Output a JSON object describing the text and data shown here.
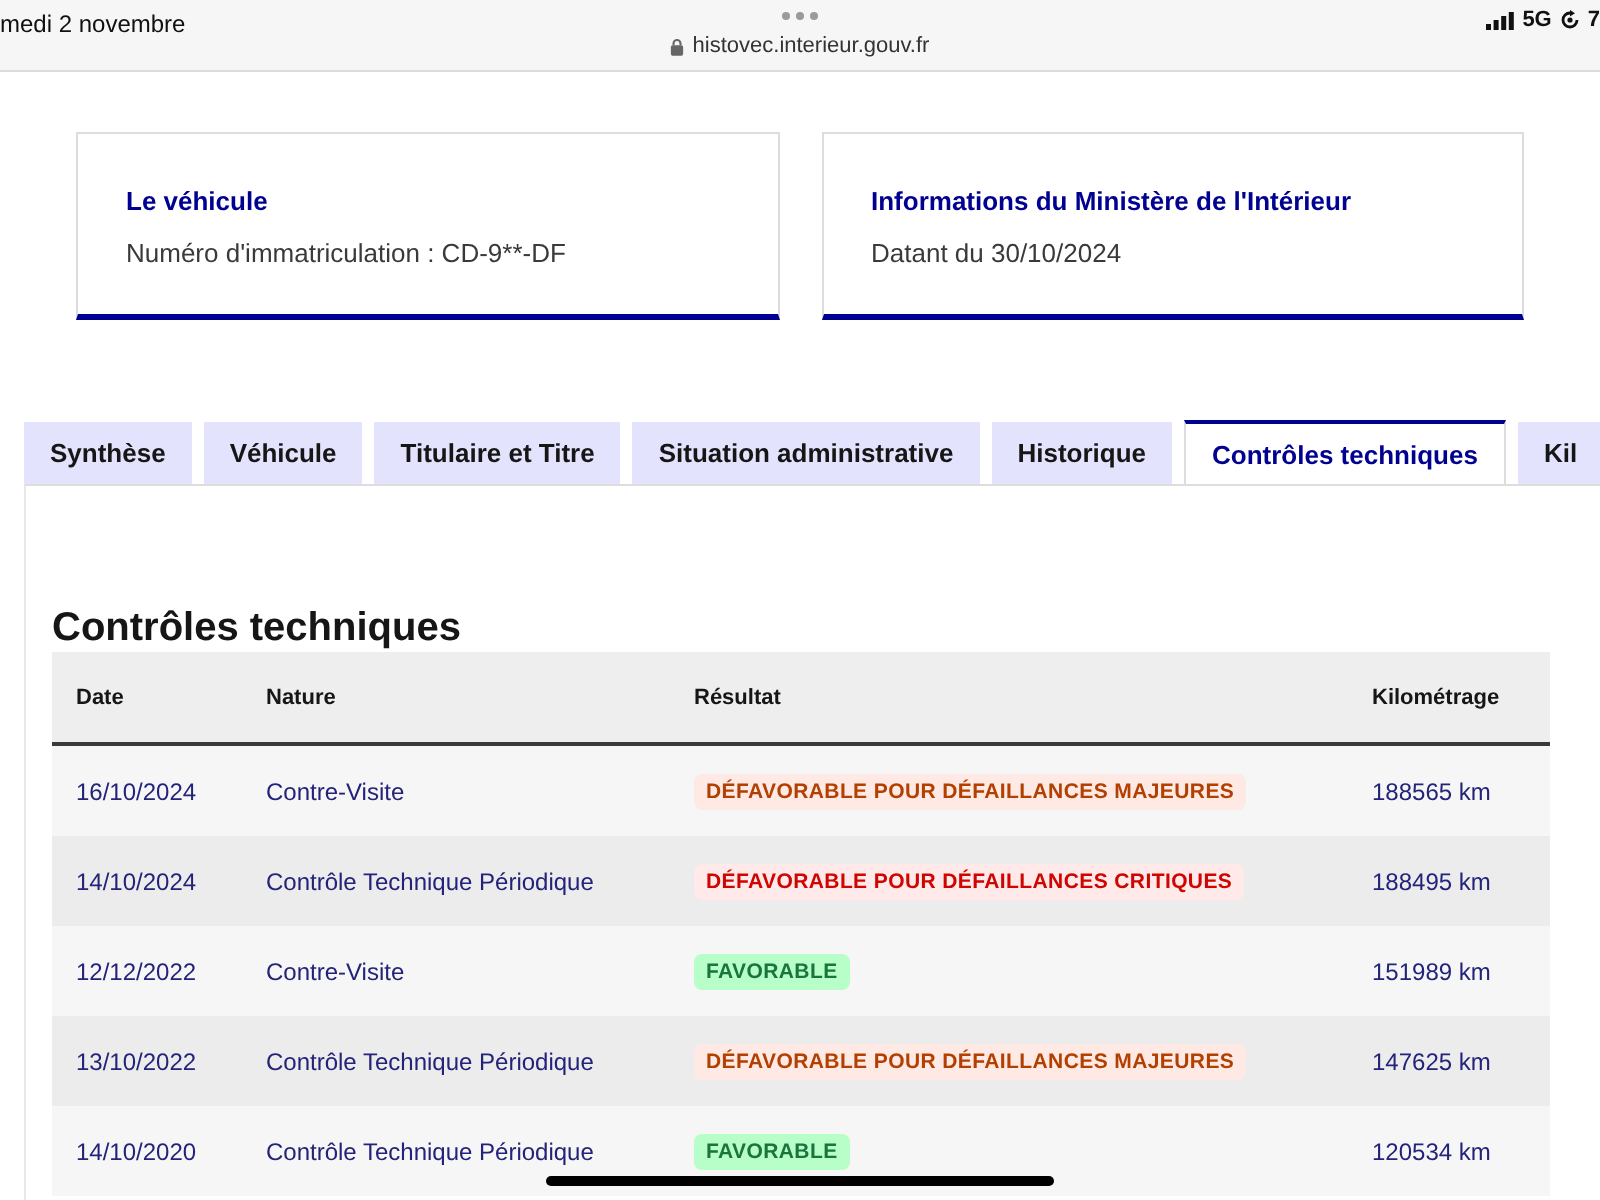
{
  "status_bar": {
    "date": "medi 2 novembre",
    "url": "histovec.interieur.gouv.fr",
    "network": "5G",
    "battery": "7"
  },
  "cards": [
    {
      "title": "Le véhicule",
      "text": "Numéro d'immatriculation : CD-9**-DF"
    },
    {
      "title": "Informations du Ministère de l'Intérieur",
      "text": "Datant du 30/10/2024"
    }
  ],
  "tabs": [
    {
      "label": "Synthèse",
      "selected": false
    },
    {
      "label": "Véhicule",
      "selected": false
    },
    {
      "label": "Titulaire et Titre",
      "selected": false
    },
    {
      "label": "Situation administrative",
      "selected": false
    },
    {
      "label": "Historique",
      "selected": false
    },
    {
      "label": "Contrôles techniques",
      "selected": true
    },
    {
      "label": "Kil",
      "selected": false
    }
  ],
  "section": {
    "title": "Contrôles techniques",
    "table": {
      "columns": [
        "Date",
        "Nature",
        "Résultat",
        "Kilométrage"
      ],
      "rows": [
        {
          "date": "16/10/2024",
          "nature": "Contre-Visite",
          "result": {
            "text": "DÉFAVORABLE POUR DÉFAILLANCES MAJEURES",
            "kind": "warning"
          },
          "mileage": "188565 km"
        },
        {
          "date": "14/10/2024",
          "nature": "Contrôle Technique Périodique",
          "result": {
            "text": "DÉFAVORABLE POUR DÉFAILLANCES CRITIQUES",
            "kind": "error"
          },
          "mileage": "188495 km"
        },
        {
          "date": "12/12/2022",
          "nature": "Contre-Visite",
          "result": {
            "text": "FAVORABLE",
            "kind": "success"
          },
          "mileage": "151989 km"
        },
        {
          "date": "13/10/2022",
          "nature": "Contrôle Technique Périodique",
          "result": {
            "text": "DÉFAVORABLE POUR DÉFAILLANCES MAJEURES",
            "kind": "warning"
          },
          "mileage": "147625 km"
        },
        {
          "date": "14/10/2020",
          "nature": "Contrôle Technique Périodique",
          "result": {
            "text": "FAVORABLE",
            "kind": "success"
          },
          "mileage": "120534 km"
        }
      ]
    }
  }
}
